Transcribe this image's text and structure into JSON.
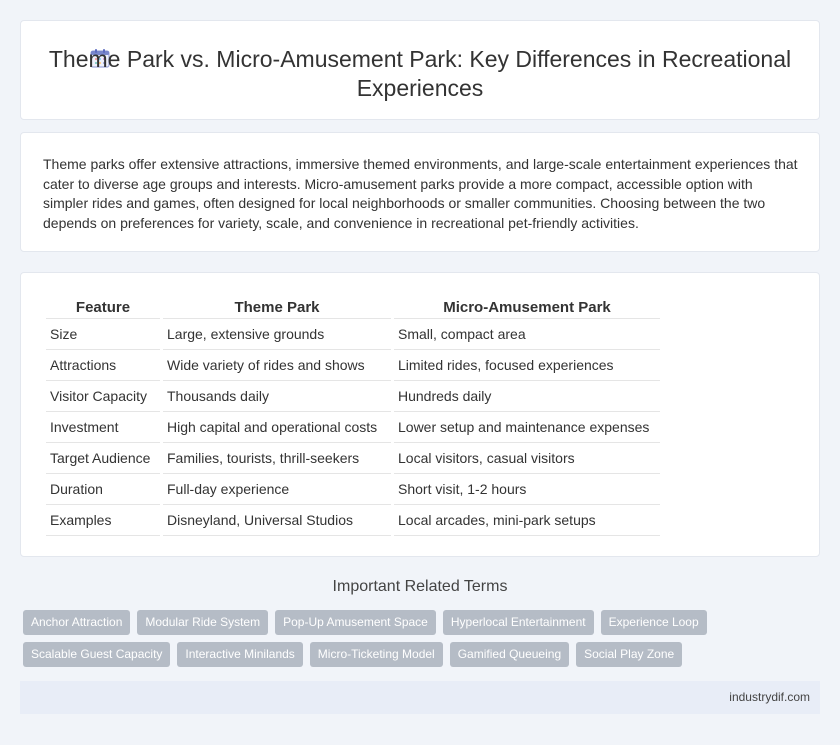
{
  "header": {
    "title": "Theme Park vs. Micro-Amusement Park: Key Differences in Recreational Experiences",
    "icon": "calendar-icon"
  },
  "intro": {
    "text": "Theme parks offer extensive attractions, immersive themed environments, and large-scale entertainment experiences that cater to diverse age groups and interests. Micro-amusement parks provide a more compact, accessible option with simpler rides and games, often designed for local neighborhoods or smaller communities. Choosing between the two depends on preferences for variety, scale, and convenience in recreational pet-friendly activities."
  },
  "table": {
    "headers": [
      "Feature",
      "Theme Park",
      "Micro-Amusement Park"
    ],
    "rows": [
      [
        "Size",
        "Large, extensive grounds",
        "Small, compact area"
      ],
      [
        "Attractions",
        "Wide variety of rides and shows",
        "Limited rides, focused experiences"
      ],
      [
        "Visitor Capacity",
        "Thousands daily",
        "Hundreds daily"
      ],
      [
        "Investment",
        "High capital and operational costs",
        "Lower setup and maintenance expenses"
      ],
      [
        "Target Audience",
        "Families, tourists, thrill-seekers",
        "Local visitors, casual visitors"
      ],
      [
        "Duration",
        "Full-day experience",
        "Short visit, 1-2 hours"
      ],
      [
        "Examples",
        "Disneyland, Universal Studios",
        "Local arcades, mini-park setups"
      ]
    ]
  },
  "related": {
    "title": "Important Related Terms",
    "row1": [
      "Anchor Attraction",
      "Modular Ride System",
      "Pop-Up Amusement Space",
      "Hyperlocal Entertainment",
      "Experience Loop"
    ],
    "row2": [
      "Scalable Guest Capacity",
      "Interactive Minilands",
      "Micro-Ticketing Model",
      "Gamified Queueing",
      "Social Play Zone"
    ]
  },
  "footer": {
    "text": "industrydif.com"
  },
  "colors": {
    "page_background": "#f1f4f9",
    "tag_background": "#b5bcc6",
    "footer_background": "#e8edf7"
  }
}
